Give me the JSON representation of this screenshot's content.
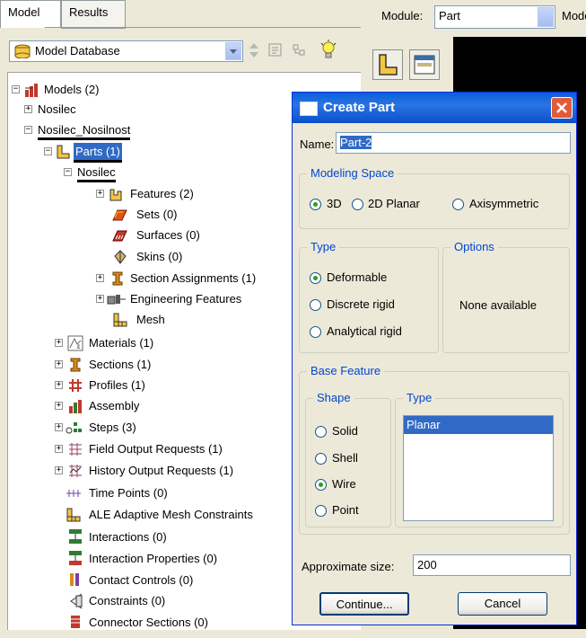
{
  "tabs": {
    "model": "Model",
    "results": "Results"
  },
  "model_db": {
    "label": "Model Database"
  },
  "tree": {
    "models": "Models (2)",
    "nosilec": "Nosilec",
    "nosilec_nosilnost": "Nosilec_Nosilnost",
    "parts": "Parts (1)",
    "part_nosilec": "Nosilec",
    "features": "Features (2)",
    "sets": "Sets (0)",
    "surfaces": "Surfaces (0)",
    "skins": "Skins (0)",
    "section_assignments": "Section Assignments (1)",
    "engineering_features": "Engineering Features",
    "mesh": "Mesh",
    "materials": "Materials (1)",
    "sections": "Sections (1)",
    "profiles": "Profiles (1)",
    "assembly": "Assembly",
    "steps": "Steps (3)",
    "field_output": "Field Output Requests (1)",
    "history_output": "History Output Requests (1)",
    "time_points": "Time Points (0)",
    "ale": "ALE Adaptive Mesh Constraints",
    "interactions": "Interactions (0)",
    "interaction_props": "Interaction Properties (0)",
    "contact_controls": "Contact Controls (0)",
    "constraints": "Constraints (0)",
    "connector_sections": "Connector Sections (0)"
  },
  "module_bar": {
    "module_label": "Module:",
    "module_value": "Part",
    "model_label": "Mode"
  },
  "dialog": {
    "title": "Create Part",
    "name_label": "Name:",
    "name_value": "Part-2",
    "modeling_space": "Modeling Space",
    "ms_3d": "3D",
    "ms_2d": "2D Planar",
    "ms_axi": "Axisymmetric",
    "type_legend": "Type",
    "type_deformable": "Deformable",
    "type_discrete": "Discrete rigid",
    "type_analytical": "Analytical rigid",
    "options_legend": "Options",
    "options_text": "None available",
    "base_feature": "Base Feature",
    "shape_legend": "Shape",
    "shape_solid": "Solid",
    "shape_shell": "Shell",
    "shape_wire": "Wire",
    "shape_point": "Point",
    "bf_type_legend": "Type",
    "bf_type_item": "Planar",
    "approx_label": "Approximate size:",
    "approx_value": "200",
    "continue": "Continue...",
    "cancel": "Cancel"
  },
  "colors": {
    "selection": "#316ac5",
    "title_bar": "#0a5fd8",
    "legend_text": "#0046d5"
  }
}
